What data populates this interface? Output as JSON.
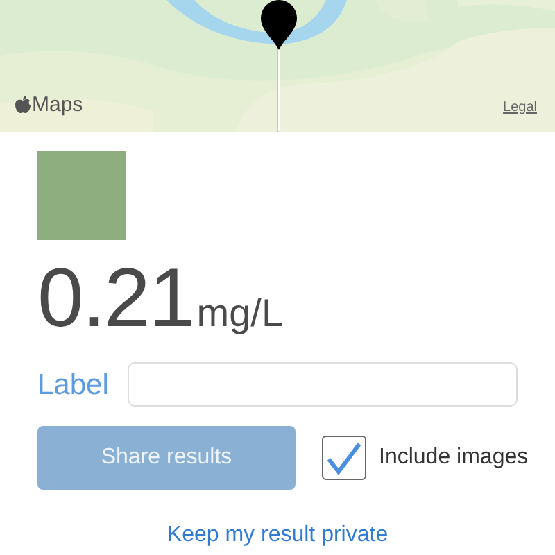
{
  "map": {
    "kind": "picture",
    "brand": "Maps",
    "legal": "Legal"
  },
  "swatch": {
    "color": "#8fae80"
  },
  "result": {
    "value": "0.21",
    "unit": "mg/L"
  },
  "label_field": {
    "label": "Label"
  },
  "share_button": {
    "label": "Share results",
    "disabled": true
  },
  "include_images": {
    "label": "Include images",
    "checked": true
  },
  "private_link": {
    "label": "Keep my result private"
  }
}
